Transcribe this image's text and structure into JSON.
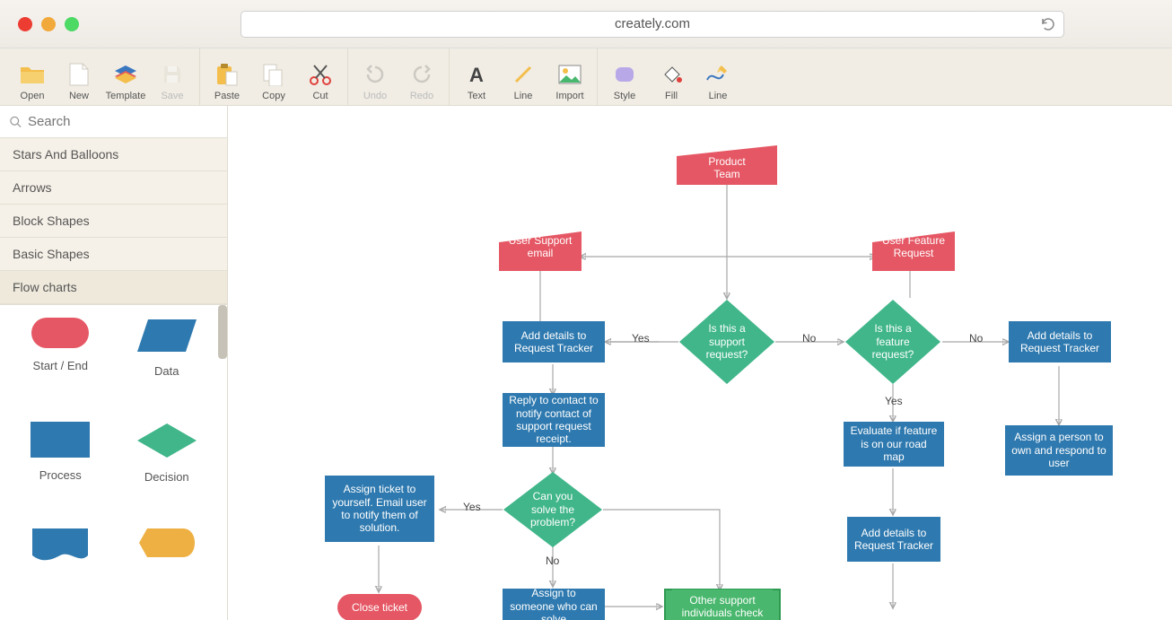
{
  "chrome": {
    "url": "creately.com"
  },
  "toolbar": {
    "open": "Open",
    "new": "New",
    "template": "Template",
    "save": "Save",
    "paste": "Paste",
    "copy": "Copy",
    "cut": "Cut",
    "undo": "Undo",
    "redo": "Redo",
    "text": "Text",
    "line": "Line",
    "import": "Import",
    "style": "Style",
    "fill": "Fill",
    "linestyle": "Line"
  },
  "sidebar": {
    "search_placeholder": "Search",
    "categories": [
      "Stars And Balloons",
      "Arrows",
      "Block Shapes",
      "Basic Shapes",
      "Flow charts"
    ],
    "palette": {
      "startend": "Start / End",
      "data": "Data",
      "process": "Process",
      "decision": "Decision"
    }
  },
  "canvas": {
    "nodes": {
      "product_team": "Product Team",
      "user_support_email": "User Support email",
      "user_feature_request": "User Feature Request",
      "is_support": "Is this a support request?",
      "is_feature": "Is this a feature request?",
      "add_details_1": "Add details to Request Tracker",
      "add_details_2": "Add details to Request Tracker",
      "add_details_3": "Add details to Request Tracker",
      "reply_contact": "Reply to contact to notify contact of support request receipt.",
      "can_solve": "Can you solve the problem?",
      "assign_ticket": "Assign ticket to yourself. Email user to notify them of solution.",
      "close_ticket": "Close ticket",
      "assign_someone": "Assign to someone who can solve",
      "other_support": "Other support individuals check",
      "evaluate_roadmap": "Evaluate if feature is on our road map",
      "assign_person": "Assign a person to own and respond to user"
    },
    "edges": {
      "yes": "Yes",
      "no": "No"
    }
  }
}
